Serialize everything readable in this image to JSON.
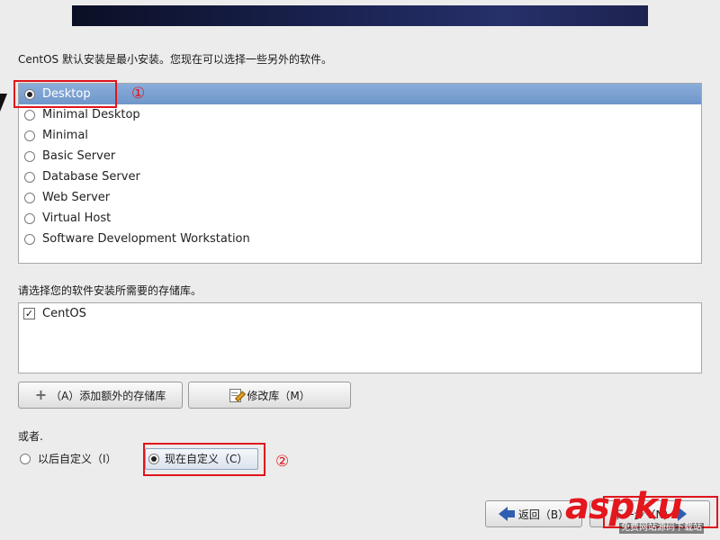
{
  "intro_text": "CentOS 默认安装是最小安装。您现在可以选择一些另外的软件。",
  "install_groups": [
    {
      "label": "Desktop",
      "selected": true
    },
    {
      "label": "Minimal Desktop",
      "selected": false
    },
    {
      "label": "Minimal",
      "selected": false
    },
    {
      "label": "Basic Server",
      "selected": false
    },
    {
      "label": "Database Server",
      "selected": false
    },
    {
      "label": "Web Server",
      "selected": false
    },
    {
      "label": "Virtual Host",
      "selected": false
    },
    {
      "label": "Software Development Workstation",
      "selected": false
    }
  ],
  "repo_section": {
    "label": "请选择您的软件安装所需要的存储库。",
    "repos": [
      {
        "label": "CentOS",
        "checked": true,
        "check_mark": "✓"
      }
    ]
  },
  "buttons": {
    "add_repo": "（A）添加额外的存储库",
    "modify_repo": "修改库（M）",
    "back": "返回（B）",
    "next": "下一步（N）"
  },
  "customize": {
    "or_label": "或者.",
    "later_label": "以后自定义（I）",
    "later_selected": false,
    "now_label": "现在自定义（C）",
    "now_selected": true
  },
  "annotations": {
    "marker_1": "①",
    "marker_2": "②",
    "color": "#e0141c"
  },
  "watermark": {
    "brand": "aspku",
    "tagline": "免费网站源码下载站"
  },
  "colors": {
    "selection": "#7a9fd2",
    "background": "#ececec",
    "banner": "#1a2250"
  },
  "icons": {
    "add": "plus-icon",
    "modify": "edit-document-icon",
    "back": "left-arrow-icon",
    "next": "right-arrow-icon"
  }
}
